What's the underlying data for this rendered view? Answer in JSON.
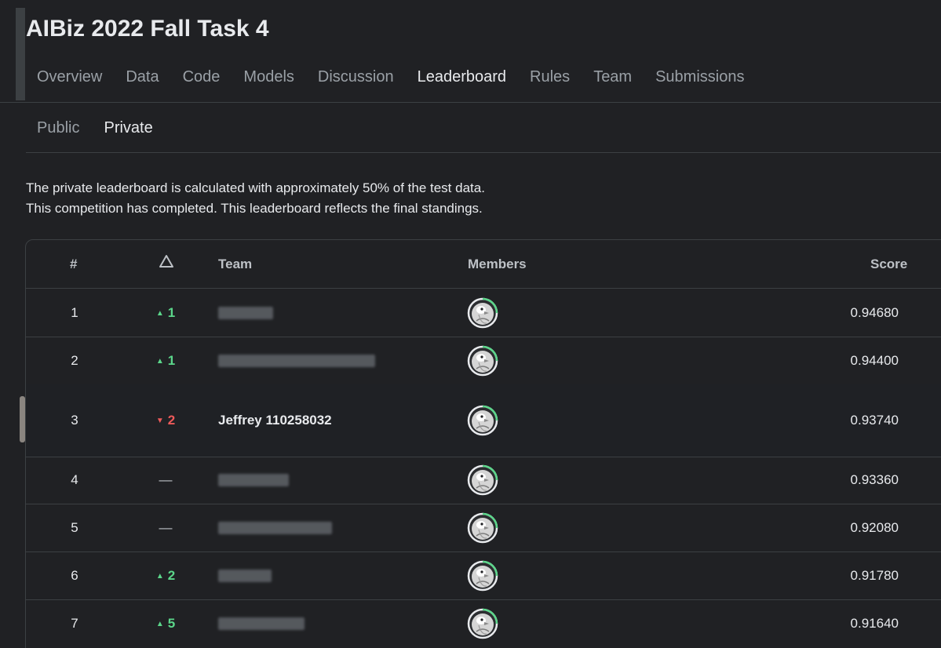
{
  "header": {
    "title": "AIBiz 2022 Fall Task 4",
    "tabs": [
      "Overview",
      "Data",
      "Code",
      "Models",
      "Discussion",
      "Leaderboard",
      "Rules",
      "Team",
      "Submissions"
    ],
    "active_tab": "Leaderboard"
  },
  "subtabs": {
    "items": [
      "Public",
      "Private"
    ],
    "active": "Private"
  },
  "description": {
    "line1": "The private leaderboard is calculated with approximately 50% of the test data.",
    "line2": "This competition has completed. This leaderboard reflects the final standings."
  },
  "table": {
    "headers": {
      "rank": "#",
      "delta_icon": "triangle-outline-icon",
      "team": "Team",
      "members": "Members",
      "score": "Score"
    },
    "rows": [
      {
        "rank": "1",
        "delta": "1",
        "delta_dir": "up",
        "team": "",
        "team_blurred": true,
        "score": "0.94680",
        "avatar_icon": "penguin-avatar-icon"
      },
      {
        "rank": "2",
        "delta": "1",
        "delta_dir": "up",
        "team": "",
        "team_blurred": true,
        "score": "0.94400",
        "avatar_icon": "penguin-avatar-icon"
      },
      {
        "rank": "3",
        "delta": "2",
        "delta_dir": "down",
        "team": "Jeffrey 110258032",
        "team_blurred": false,
        "score": "0.93740",
        "avatar_icon": "penguin-avatar-icon",
        "highlight": true
      },
      {
        "rank": "4",
        "delta": "—",
        "delta_dir": "same",
        "team": "",
        "team_blurred": true,
        "score": "0.93360",
        "avatar_icon": "penguin-avatar-icon"
      },
      {
        "rank": "5",
        "delta": "—",
        "delta_dir": "same",
        "team": "",
        "team_blurred": true,
        "score": "0.92080",
        "avatar_icon": "penguin-avatar-icon"
      },
      {
        "rank": "6",
        "delta": "2",
        "delta_dir": "up",
        "team": "",
        "team_blurred": true,
        "score": "0.91780",
        "avatar_icon": "penguin-avatar-icon"
      },
      {
        "rank": "7",
        "delta": "5",
        "delta_dir": "up",
        "team": "",
        "team_blurred": true,
        "score": "0.91640",
        "avatar_icon": "penguin-avatar-icon"
      }
    ]
  },
  "colors": {
    "background": "#202124",
    "border": "#3c4043",
    "up": "#5bd68a",
    "down": "#ee5a5a",
    "avatar_ring": "#5bd68a"
  }
}
